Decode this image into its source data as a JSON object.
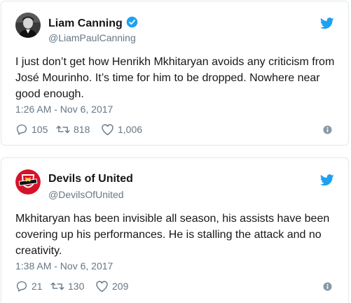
{
  "tweets": [
    {
      "author_name": "Liam Canning",
      "verified": true,
      "handle": "@LiamPaulCanning",
      "text": "I just don’t get how Henrikh Mkhitaryan avoids any criticism from José Mourinho. It’s time for him to be dropped. Nowhere near good enough.",
      "timestamp": "1:26 AM - Nov 6, 2017",
      "replies": "105",
      "retweets": "818",
      "likes": "1,006"
    },
    {
      "author_name": "Devils of United",
      "verified": false,
      "handle": "@DevilsOfUnited",
      "text": "Mkhitaryan has been invisible all season, his assists have been covering up his performances. He is stalling the attack and no creativity.",
      "timestamp": "1:38 AM - Nov 6, 2017",
      "replies": "21",
      "retweets": "130",
      "likes": "209"
    }
  ],
  "icons": {
    "brand": "twitter-bird-icon",
    "reply": "reply-icon",
    "retweet": "retweet-icon",
    "like": "heart-icon",
    "info": "info-icon",
    "verified": "verified-badge-icon"
  },
  "colors": {
    "twitter_blue": "#1da1f2",
    "text_primary": "#14171a",
    "text_secondary": "#657786",
    "border": "#e1e8ed"
  }
}
